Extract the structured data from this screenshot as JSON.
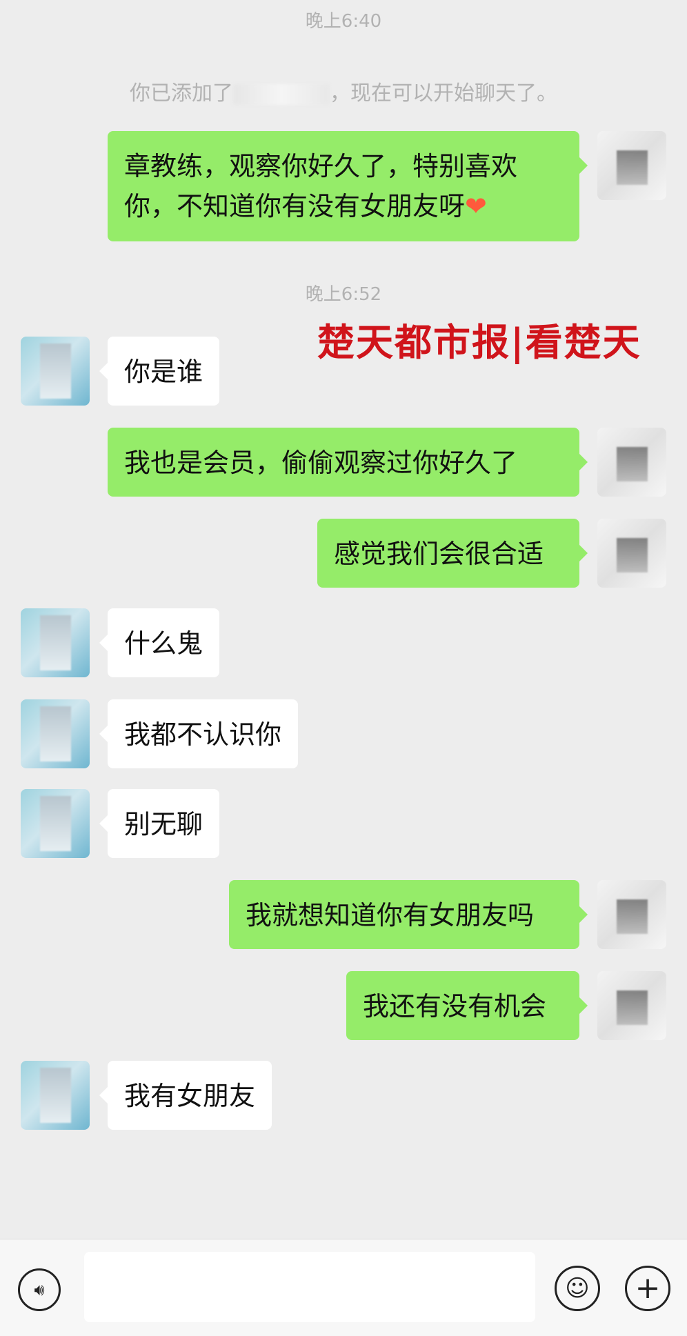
{
  "timestamps": {
    "first": "晚上6:40",
    "second": "晚上6:52"
  },
  "system_message": {
    "prefix": "你已添加了",
    "suffix": "，现在可以开始聊天了。"
  },
  "watermark": "楚天都市报|看楚天",
  "messages": [
    {
      "side": "right",
      "text": "章教练，观察你好久了，特别喜欢你，不知道你有没有女朋友呀",
      "emoji": "❤"
    },
    {
      "side": "left",
      "text": "你是谁"
    },
    {
      "side": "right",
      "text": "我也是会员，偷偷观察过你好久了"
    },
    {
      "side": "right",
      "text": "感觉我们会很合适"
    },
    {
      "side": "left",
      "text": "什么鬼"
    },
    {
      "side": "left",
      "text": "我都不认识你"
    },
    {
      "side": "left",
      "text": "别无聊"
    },
    {
      "side": "right",
      "text": "我就想知道你有女朋友吗"
    },
    {
      "side": "right",
      "text": "我还有没有机会"
    },
    {
      "side": "left",
      "text": "我有女朋友"
    }
  ],
  "input_bar": {
    "value": "",
    "voice_icon": "voice-icon",
    "emoji_icon": "emoji-icon",
    "plus_icon": "plus-icon"
  },
  "colors": {
    "background": "#ededed",
    "sent_bubble": "#95ec69",
    "received_bubble": "#ffffff",
    "watermark": "#d0141b"
  }
}
